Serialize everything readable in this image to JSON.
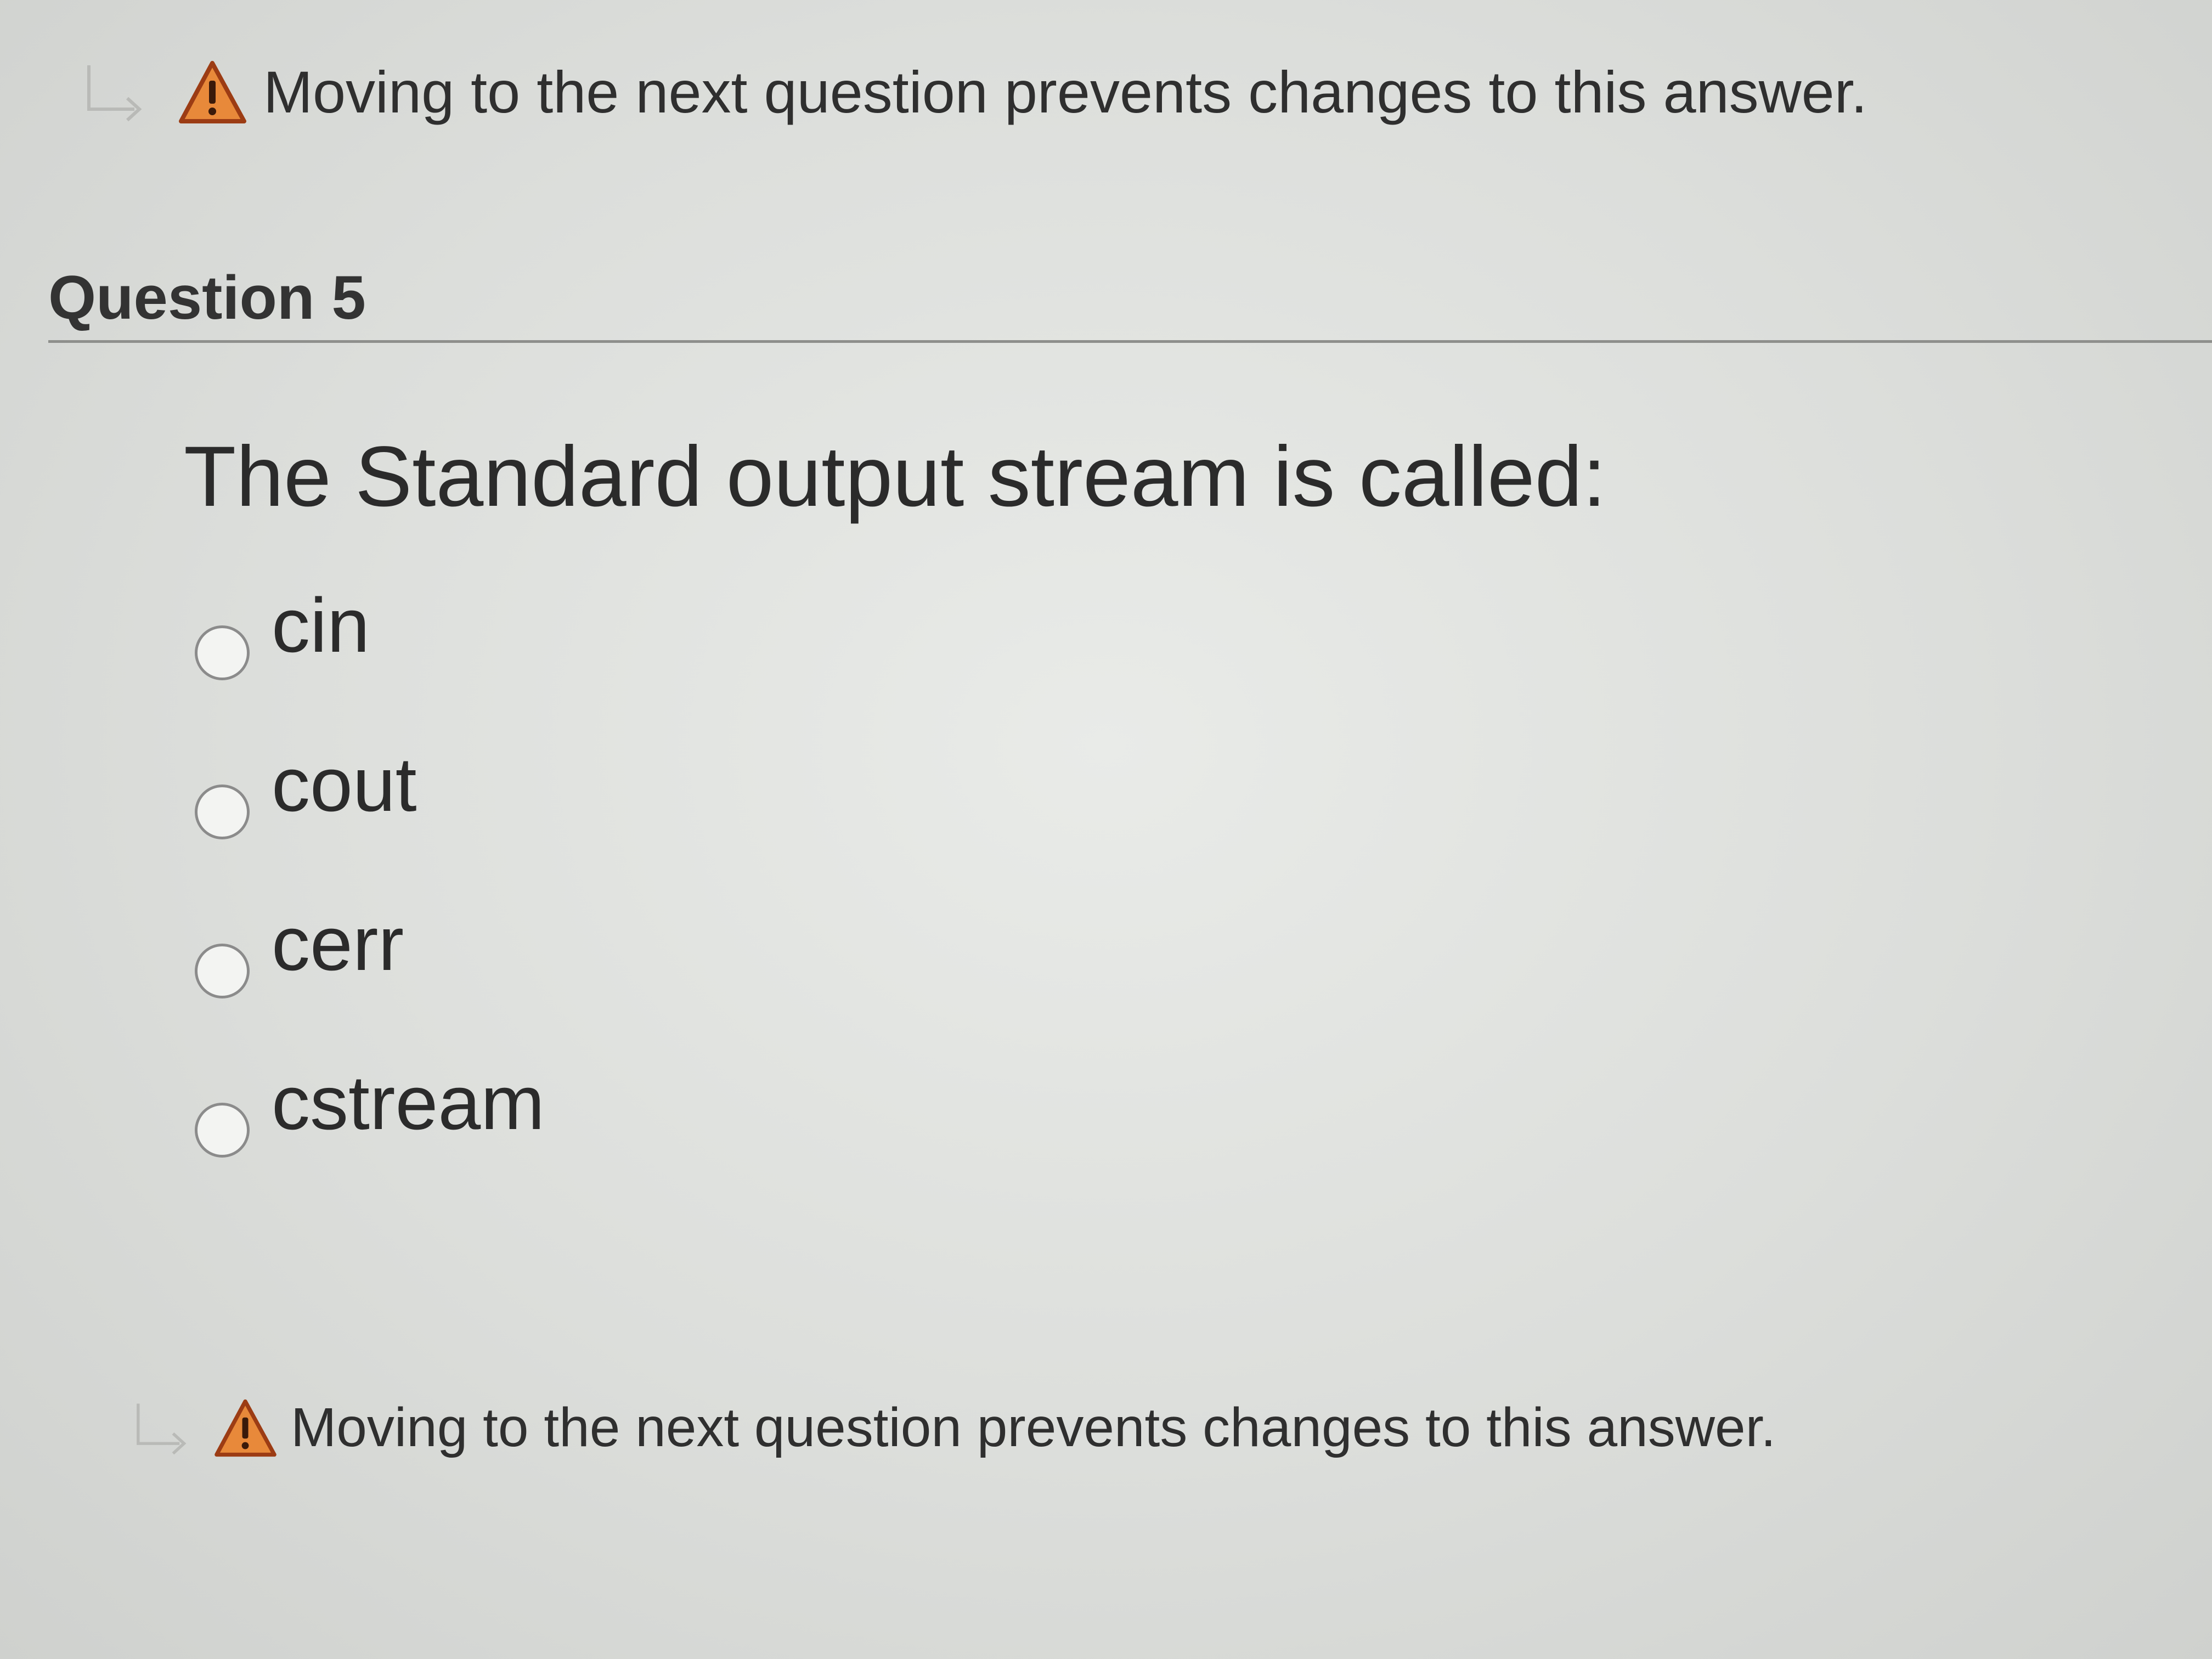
{
  "notice_top": {
    "text": "Moving to the next question prevents changes to this answer."
  },
  "question": {
    "title": "Question 5",
    "prompt": "The Standard output stream is called:",
    "options": [
      {
        "label": "cin",
        "selected": false
      },
      {
        "label": "cout",
        "selected": false
      },
      {
        "label": "cerr",
        "selected": false
      },
      {
        "label": "cstream",
        "selected": false
      }
    ]
  },
  "notice_bottom": {
    "text": "Moving to the next question prevents changes to this answer."
  },
  "icons": {
    "arrow": "return-arrow-icon",
    "warning": "warning-icon"
  },
  "colors": {
    "warning_fill": "#e8893a",
    "warning_stroke": "#9c3c14",
    "arrow": "#b9bab7"
  }
}
